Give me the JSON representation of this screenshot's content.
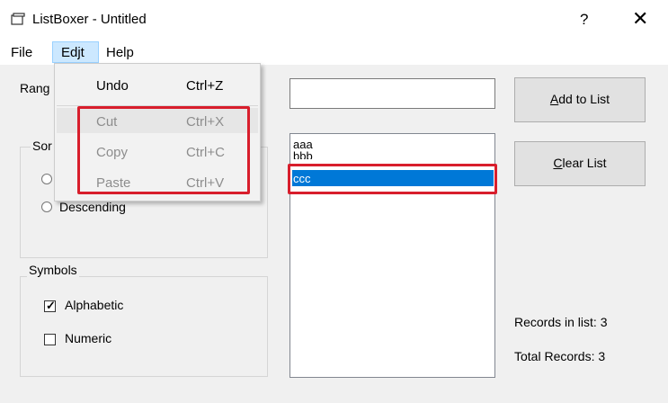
{
  "window": {
    "title": "ListBoxer - Untitled",
    "help_button": "?",
    "close_button": "✕"
  },
  "menubar": {
    "file": "File",
    "edit": "Edjt",
    "help": "Help"
  },
  "edit_menu": {
    "items": [
      {
        "label": "Undo",
        "shortcut": "Ctrl+Z",
        "enabled": true
      },
      {
        "label": "Cut",
        "shortcut": "Ctrl+X",
        "enabled": false
      },
      {
        "label": "Copy",
        "shortcut": "Ctrl+C",
        "enabled": false
      },
      {
        "label": "Paste",
        "shortcut": "Ctrl+V",
        "enabled": false
      }
    ]
  },
  "form": {
    "range_label_partial": "Rang",
    "sort_group_partial": "Sor",
    "sort_descending": "Descending",
    "symbols_group": "Symbols",
    "alphabetic": "Alphabetic",
    "alphabetic_checked": true,
    "numeric": "Numeric",
    "numeric_checked": false,
    "input_value": "",
    "list_items": [
      "aaa",
      "bbb",
      "ccc"
    ],
    "selected_item": "ccc",
    "add_button": "Add to List",
    "add_button_accel": "A",
    "add_button_rest": "dd to List",
    "clear_button": "Clear List",
    "clear_button_accel": "C",
    "clear_button_rest": "lear List",
    "records_in_list": "Records in list: 3",
    "total_records": "Total Records: 3"
  },
  "colors": {
    "selection": "#0078d7",
    "highlight_box": "#d81e2c",
    "menu_highlight": "#cce8ff"
  }
}
